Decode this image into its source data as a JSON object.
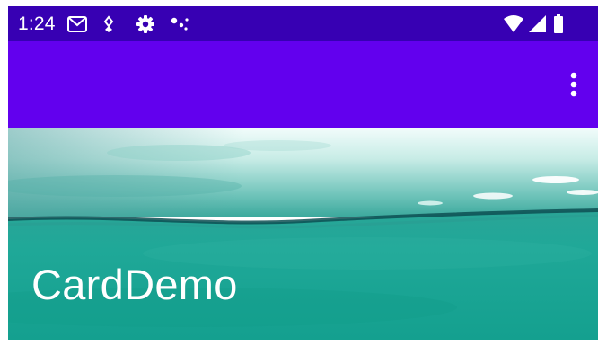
{
  "status_bar": {
    "time": "1:24",
    "left_icons": [
      "gmail-icon",
      "usb-debug-icon",
      "settings-gear-icon",
      "dots-icon"
    ],
    "right_icons": [
      "wifi-icon",
      "cell-signal-icon",
      "battery-icon"
    ]
  },
  "app_bar": {
    "overflow_icon": "more-vert-icon"
  },
  "header": {
    "title": "CardDemo"
  },
  "colors": {
    "status_bar": "#3700b3",
    "app_bar": "#6200ee",
    "water": "#17a99a",
    "sky": "#e6f7f5"
  }
}
